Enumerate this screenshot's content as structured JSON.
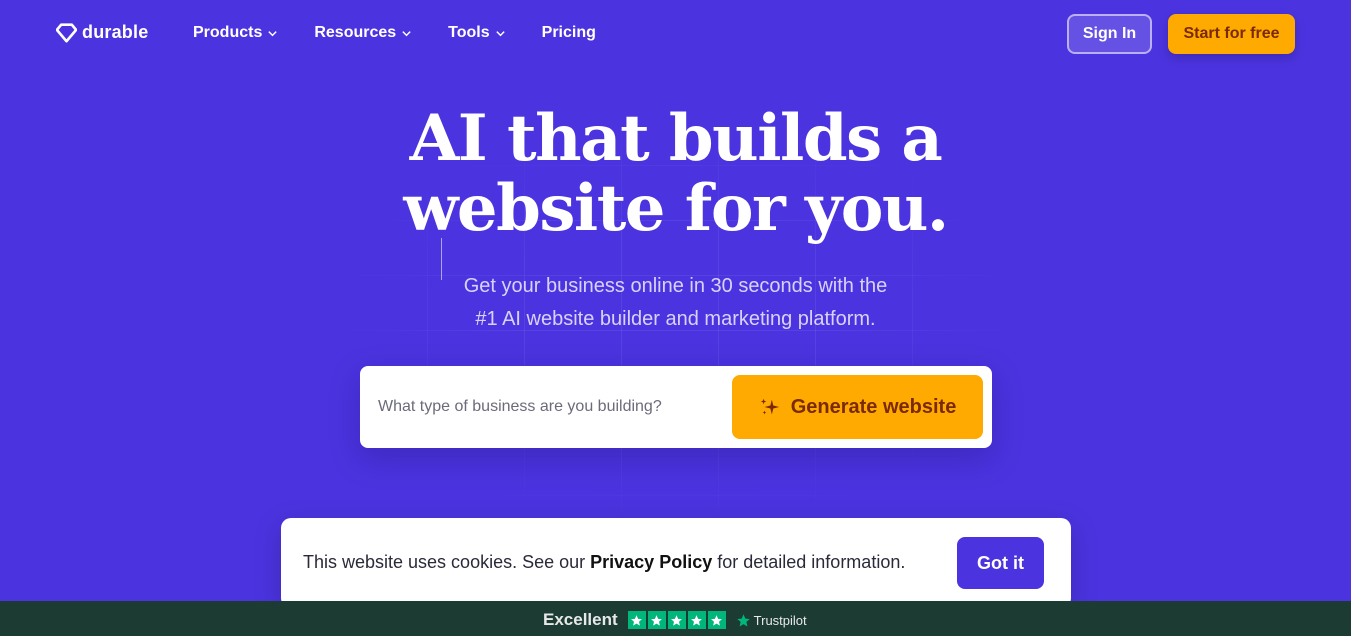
{
  "brand": {
    "name": "durable",
    "logo_icon": "diamond-logo-icon"
  },
  "nav": {
    "items": [
      {
        "label": "Products",
        "has_dropdown": true
      },
      {
        "label": "Resources",
        "has_dropdown": true
      },
      {
        "label": "Tools",
        "has_dropdown": true
      },
      {
        "label": "Pricing",
        "has_dropdown": false
      }
    ],
    "sign_in": "Sign In",
    "start": "Start for free"
  },
  "hero": {
    "title_line1": "AI that builds a",
    "title_line2": "website for you.",
    "subtitle_line1": "Get your business online in 30 seconds with the",
    "subtitle_line2": "#1 AI website builder and marketing platform."
  },
  "search": {
    "placeholder": "What type of business are you building?",
    "value": "",
    "button": "Generate website",
    "button_icon": "sparkle-icon"
  },
  "cookie": {
    "text_before": "This website uses cookies. See our ",
    "link": "Privacy Policy",
    "text_after": " for detailed information.",
    "button": "Got it"
  },
  "trustpilot": {
    "rating_text": "Excellent",
    "stars": 5,
    "brand": "Trustpilot"
  },
  "colors": {
    "background": "#4B33DF",
    "accent": "#FFAA00",
    "accent_text": "#7A2A00",
    "trust_bar": "#1B3B33",
    "trust_star": "#00B67A"
  }
}
